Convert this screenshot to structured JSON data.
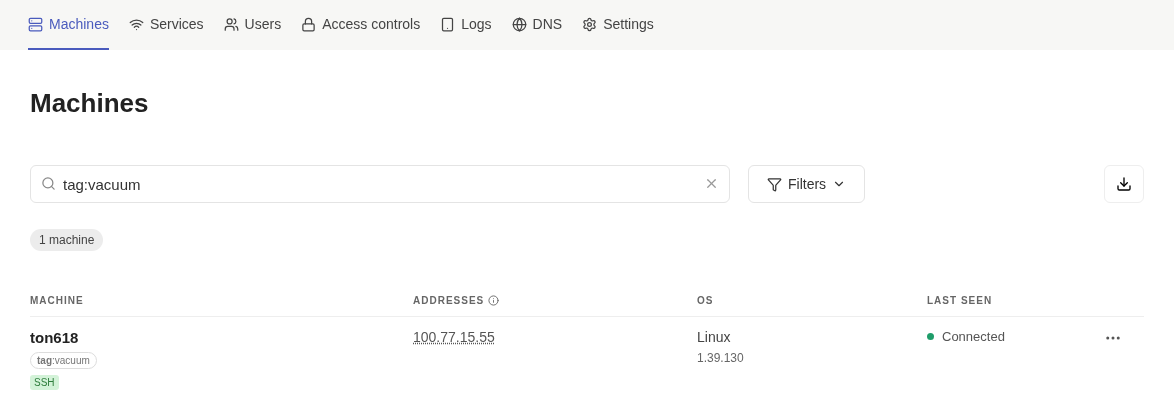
{
  "tabs": [
    {
      "label": "Machines",
      "selected": true
    },
    {
      "label": "Services",
      "selected": false
    },
    {
      "label": "Users",
      "selected": false
    },
    {
      "label": "Access controls",
      "selected": false
    },
    {
      "label": "Logs",
      "selected": false
    },
    {
      "label": "DNS",
      "selected": false
    },
    {
      "label": "Settings",
      "selected": false
    }
  ],
  "title": "Machines",
  "search": {
    "value": "tag:vacuum"
  },
  "filters_button": "Filters",
  "count_badge": "1 machine",
  "table": {
    "columns": [
      "MACHINE",
      "ADDRESSES",
      "OS",
      "LAST SEEN"
    ],
    "rows": [
      {
        "name": "ton618",
        "tag": "**tag**:vacuum",
        "badge": "SSH",
        "address": "100.77.15.55",
        "os": "Linux",
        "version": "1.39.130",
        "status": "Connected",
        "online": true
      }
    ]
  }
}
